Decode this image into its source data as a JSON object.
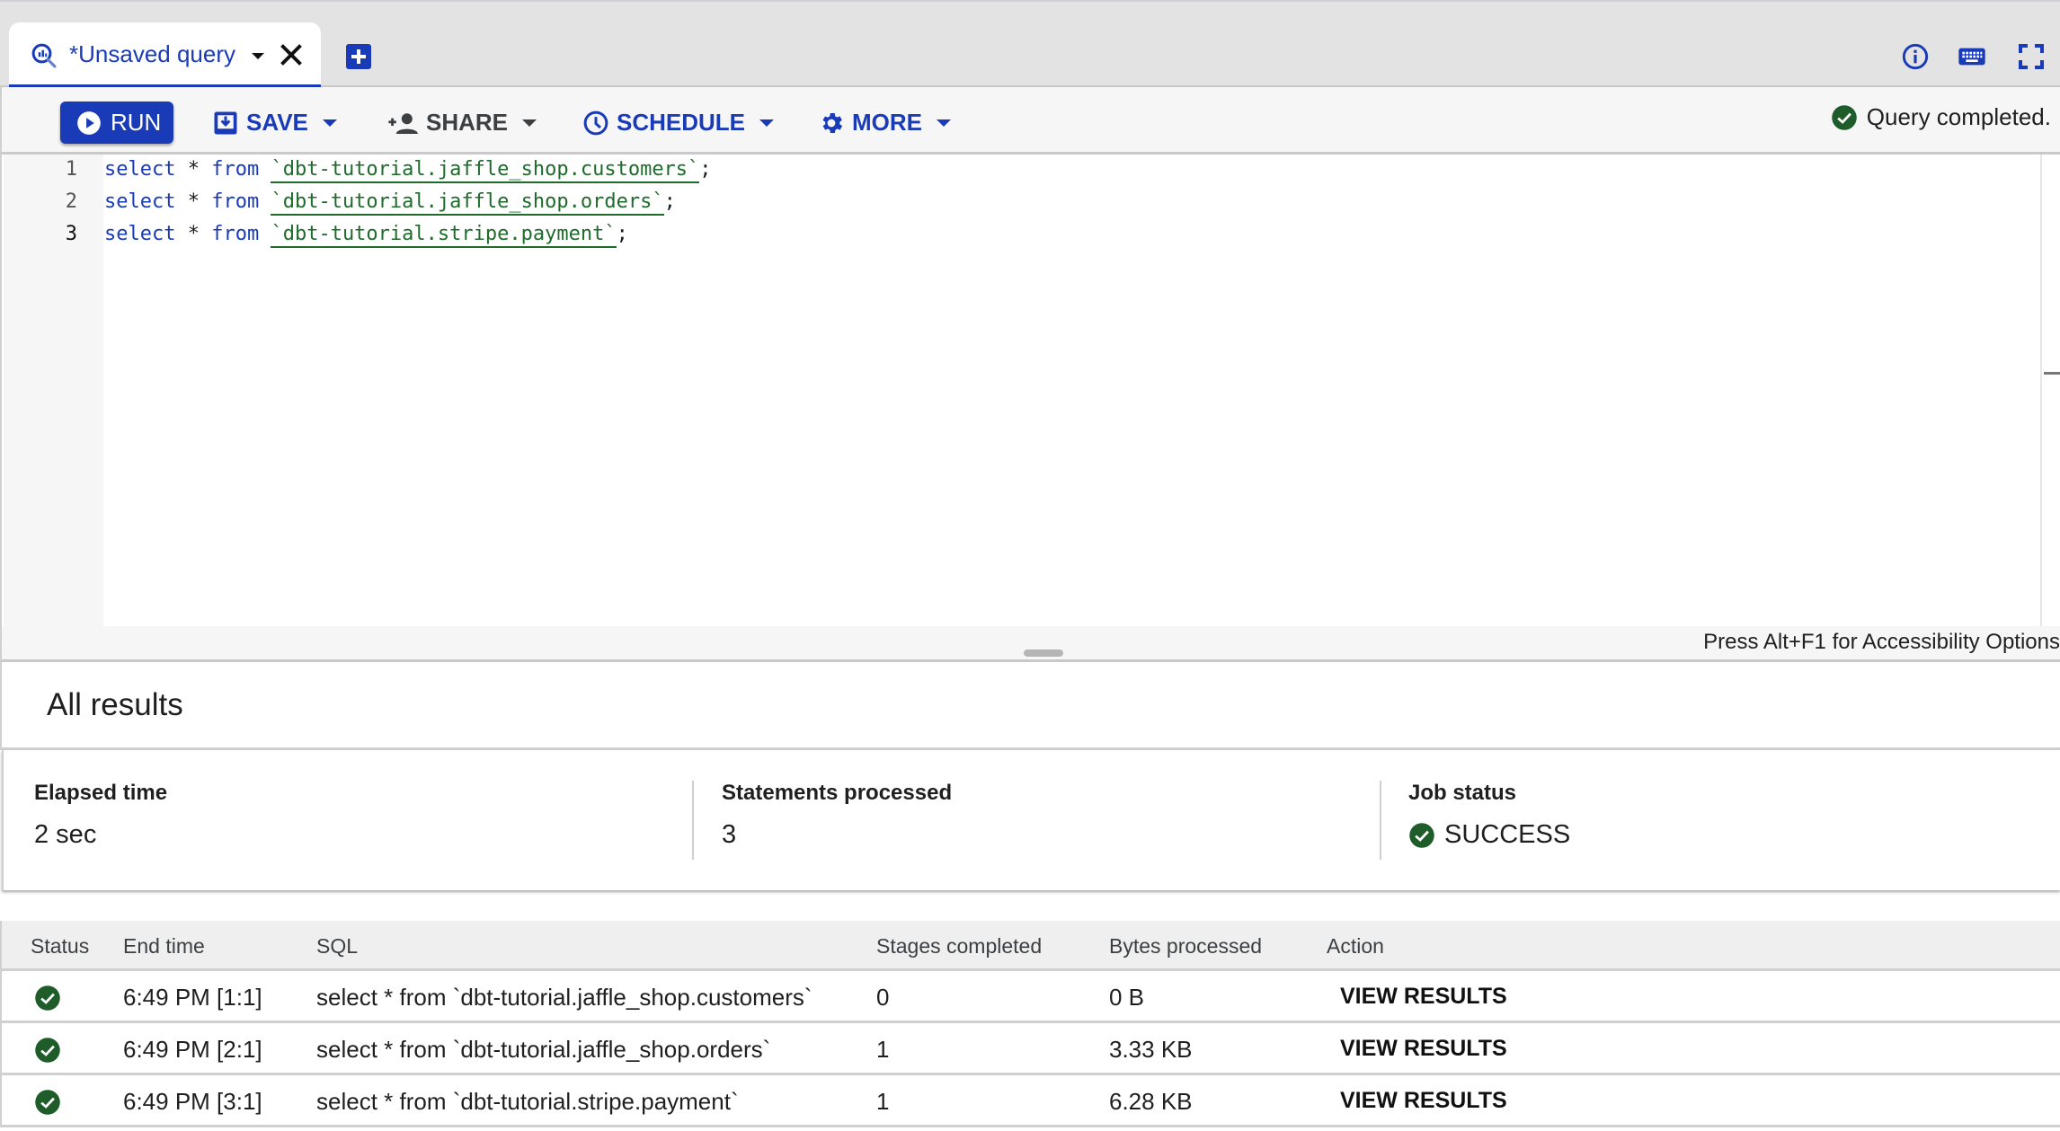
{
  "tab": {
    "title": "*Unsaved query",
    "icon": "query-search-icon",
    "close_icon": "close-icon",
    "new_tab_icon": "add-box-icon"
  },
  "top_icons": [
    "info-icon",
    "keyboard-icon",
    "fullscreen-icon"
  ],
  "toolbar": {
    "run_label": "RUN",
    "save_label": "SAVE",
    "share_label": "SHARE",
    "schedule_label": "SCHEDULE",
    "more_label": "MORE",
    "status_text": "Query completed."
  },
  "editor": {
    "lines": [
      {
        "num": "1",
        "keyword1": "select",
        "op": " * ",
        "keyword2": "from",
        "table": "`dbt-tutorial.jaffle_shop.customers`",
        "end": ";"
      },
      {
        "num": "2",
        "keyword1": "select",
        "op": " * ",
        "keyword2": "from",
        "table": "`dbt-tutorial.jaffle_shop.orders`",
        "end": ";"
      },
      {
        "num": "3",
        "keyword1": "select",
        "op": " * ",
        "keyword2": "from",
        "table": "`dbt-tutorial.stripe.payment`",
        "end": ";"
      }
    ],
    "accessibility_hint": "Press Alt+F1 for Accessibility Options"
  },
  "results": {
    "title": "All results",
    "summary": {
      "elapsed_label": "Elapsed time",
      "elapsed_value": "2 sec",
      "statements_label": "Statements processed",
      "statements_value": "3",
      "job_status_label": "Job status",
      "job_status_value": "SUCCESS"
    },
    "table": {
      "headers": [
        "Status",
        "End time",
        "SQL",
        "Stages completed",
        "Bytes processed",
        "Action"
      ],
      "rows": [
        {
          "status": "success",
          "end_time": "6:49 PM [1:1]",
          "sql": "select * from `dbt-tutorial.jaffle_shop.customers`",
          "stages": "0",
          "bytes": "0 B",
          "action": "VIEW RESULTS"
        },
        {
          "status": "success",
          "end_time": "6:49 PM [2:1]",
          "sql": "select * from `dbt-tutorial.jaffle_shop.orders`",
          "stages": "1",
          "bytes": "3.33 KB",
          "action": "VIEW RESULTS"
        },
        {
          "status": "success",
          "end_time": "6:49 PM [3:1]",
          "sql": "select * from `dbt-tutorial.stripe.payment`",
          "stages": "1",
          "bytes": "6.28 KB",
          "action": "VIEW RESULTS"
        }
      ]
    }
  },
  "colors": {
    "accent": "#1a3bb7",
    "success": "#1e5c2a",
    "code_table": "#1e6b2c"
  }
}
